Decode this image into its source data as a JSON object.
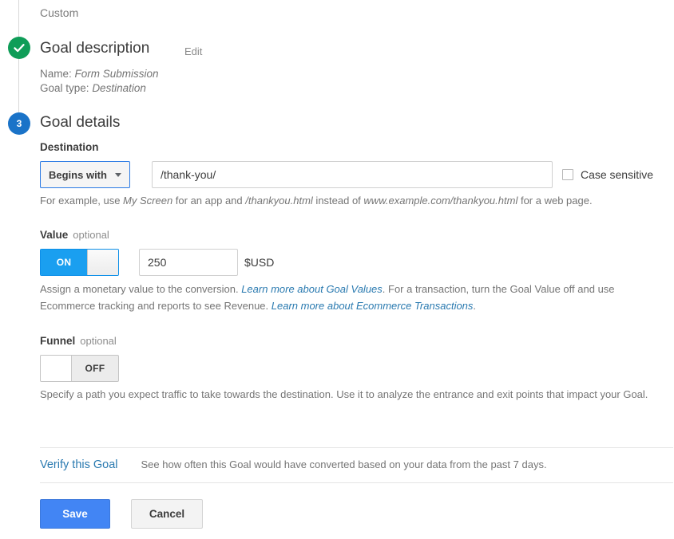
{
  "breadcrumb": {
    "custom_label": "Custom"
  },
  "steps": {
    "description": {
      "title": "Goal description",
      "edit_label": "Edit",
      "name_line": "Name:",
      "name_value": "Form Submission",
      "type_line": "Goal type:",
      "type_value": "Destination",
      "marker_icon": "check-icon",
      "marker_color": "#0f9d58"
    },
    "details": {
      "number": "3",
      "title": "Goal details",
      "marker_color": "#1a73c8"
    }
  },
  "destination": {
    "label": "Destination",
    "match_type": "Begins with",
    "value": "/thank-you/",
    "placeholder": "",
    "case_sensitive_label": "Case sensitive",
    "case_sensitive_checked": false,
    "helper_prefix": "For example, use ",
    "helper_em1": "My Screen",
    "helper_mid1": " for an app and ",
    "helper_em2": "/thankyou.html",
    "helper_mid2": " instead of ",
    "helper_em3": "www.example.com/thankyou.html",
    "helper_suffix": " for a web page."
  },
  "value": {
    "label": "Value",
    "optional": "optional",
    "toggle_state": "ON",
    "amount": "250",
    "currency": "$USD",
    "helper_part1": "Assign a monetary value to the conversion. ",
    "helper_link1": "Learn more about Goal Values",
    "helper_part2": ". For a transaction, turn the Goal Value off and use Ecommerce tracking and reports to see Revenue. ",
    "helper_link2": "Learn more about Ecommerce Transactions",
    "helper_part3": "."
  },
  "funnel": {
    "label": "Funnel",
    "optional": "optional",
    "toggle_state": "OFF",
    "helper": "Specify a path you expect traffic to take towards the destination. Use it to analyze the entrance and exit points that impact your Goal."
  },
  "verify": {
    "link_label": "Verify this Goal",
    "note": "See how often this Goal would have converted based on your data from the past 7 days."
  },
  "actions": {
    "save_label": "Save",
    "cancel_label": "Cancel",
    "save_color": "#4285f4"
  }
}
